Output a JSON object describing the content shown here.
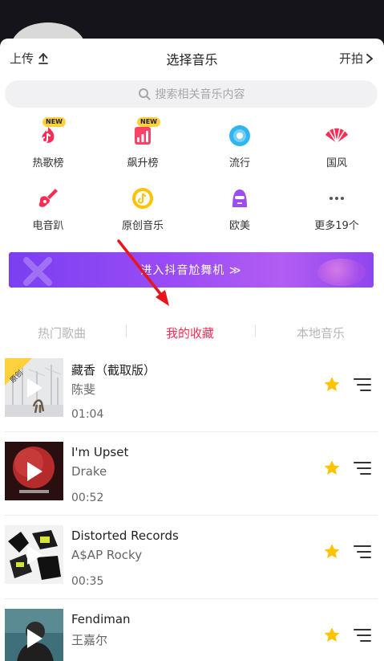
{
  "header": {
    "upload_label": "上传",
    "title": "选择音乐",
    "shoot_label": "开拍"
  },
  "search": {
    "placeholder": "搜索相关音乐内容"
  },
  "categories": [
    {
      "label": "热歌榜",
      "icon": "hot-chart-icon",
      "badge": "NEW"
    },
    {
      "label": "飙升榜",
      "icon": "rising-chart-icon",
      "badge": "NEW"
    },
    {
      "label": "流行",
      "icon": "pop-icon"
    },
    {
      "label": "国风",
      "icon": "chinese-style-fan-icon"
    },
    {
      "label": "电音趴",
      "icon": "electric-guitar-icon"
    },
    {
      "label": "原创音乐",
      "icon": "original-music-icon"
    },
    {
      "label": "欧美",
      "icon": "western-singer-icon"
    },
    {
      "label": "更多19个",
      "icon": "more-dots-icon"
    }
  ],
  "banner": {
    "text": "进入抖音尬舞机 ≫"
  },
  "tabs": [
    {
      "label": "热门歌曲",
      "active": false
    },
    {
      "label": "我的收藏",
      "active": true
    },
    {
      "label": "本地音乐",
      "active": false
    }
  ],
  "songs": [
    {
      "title": "藏香（截取版）",
      "artist": "陈斐",
      "duration": "01:04",
      "corner_label": "原创",
      "favorited": true
    },
    {
      "title": "I'm Upset",
      "artist": "Drake",
      "duration": "00:52",
      "favorited": true
    },
    {
      "title": "Distorted Records",
      "artist": "A$AP Rocky",
      "duration": "00:35",
      "favorited": true
    },
    {
      "title": "Fendiman",
      "artist": "王嘉尔",
      "duration": "",
      "favorited": true
    }
  ],
  "colors": {
    "accent": "#fe2c55",
    "star": "#ffc300",
    "banner_start": "#7a3ff0",
    "annotation_arrow": "#e8161a"
  }
}
